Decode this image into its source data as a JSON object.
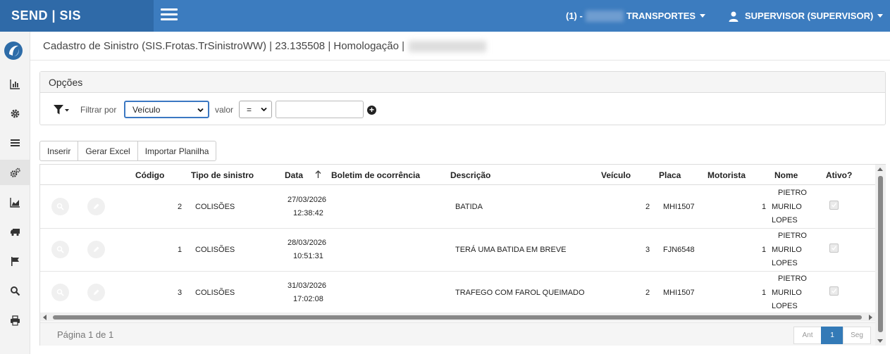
{
  "topbar": {
    "brand": "SEND | SIS",
    "company_prefix": "(1) -",
    "company_name": "TRANSPORTES",
    "user": "SUPERVISOR (SUPERVISOR)"
  },
  "sidebar": {
    "items": [
      "chart-bar-icon",
      "gear-icon",
      "list-icon",
      "gears-icon",
      "area-chart-icon",
      "truck-icon",
      "flag-icon",
      "search-icon",
      "print-icon"
    ]
  },
  "header": {
    "title": "Cadastro de Sinistro (SIS.Frotas.TrSinistroWW) | 23.135508 | Homologação |"
  },
  "options": {
    "title": "Opções",
    "filter_label": "Filtrar por",
    "filter_value": "Veículo",
    "value_label": "valor",
    "operator": "="
  },
  "buttons": {
    "insert": "Inserir",
    "excel": "Gerar Excel",
    "import": "Importar Planilha"
  },
  "grid": {
    "columns": {
      "codigo": "Código",
      "tipo": "Tipo de sinistro",
      "data": "Data",
      "boletim": "Boletim de ocorrência",
      "descricao": "Descrição",
      "veiculo": "Veículo",
      "placa": "Placa",
      "motorista": "Motorista",
      "nome": "Nome",
      "ativo": "Ativo?"
    },
    "rows": [
      {
        "codigo": "2",
        "tipo": "COLISÕES",
        "date": "27/03/2026",
        "time": "12:38:42",
        "descricao": "BATIDA",
        "veiculo": "2",
        "placa": "MHI1507",
        "motorista": "1",
        "nome1": "PIETRO",
        "nome2": "MURILO",
        "nome3": "LOPES"
      },
      {
        "codigo": "1",
        "tipo": "COLISÕES",
        "date": "28/03/2026",
        "time": "10:51:31",
        "descricao": "TERÁ UMA BATIDA EM BREVE",
        "veiculo": "3",
        "placa": "FJN6548",
        "motorista": "1",
        "nome1": "PIETRO",
        "nome2": "MURILO",
        "nome3": "LOPES"
      },
      {
        "codigo": "3",
        "tipo": "COLISÕES",
        "date": "31/03/2026",
        "time": "17:02:08",
        "descricao": "TRAFEGO COM FAROL QUEIMADO",
        "veiculo": "2",
        "placa": "MHI1507",
        "motorista": "1",
        "nome1": "PIETRO",
        "nome2": "MURILO",
        "nome3": "LOPES"
      }
    ],
    "footer": {
      "page_info": "Página 1 de 1",
      "prev": "Ant",
      "current": "1",
      "next": "Seg"
    }
  },
  "colors": {
    "topbar": "#3c7cbf",
    "brand_bg": "#2f6aa8",
    "active_page": "#337ab7"
  }
}
